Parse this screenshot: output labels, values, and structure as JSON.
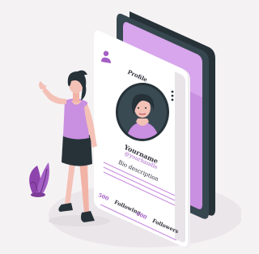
{
  "profile": {
    "title": "Profile",
    "name": "Yourname",
    "handle": "@yourhandle",
    "bio": "Bio description",
    "following_count": "500",
    "following_label": "Following",
    "followers_count": "600",
    "followers_label": "Followers"
  },
  "colors": {
    "accent": "#a45fc4",
    "accent_light": "#e4b8f1",
    "dark": "#263238",
    "phone_white": "#ffffff",
    "background": "#f5f2f4"
  },
  "icons": [
    "user-icon",
    "more-vertical-icon",
    "plant-icon"
  ]
}
